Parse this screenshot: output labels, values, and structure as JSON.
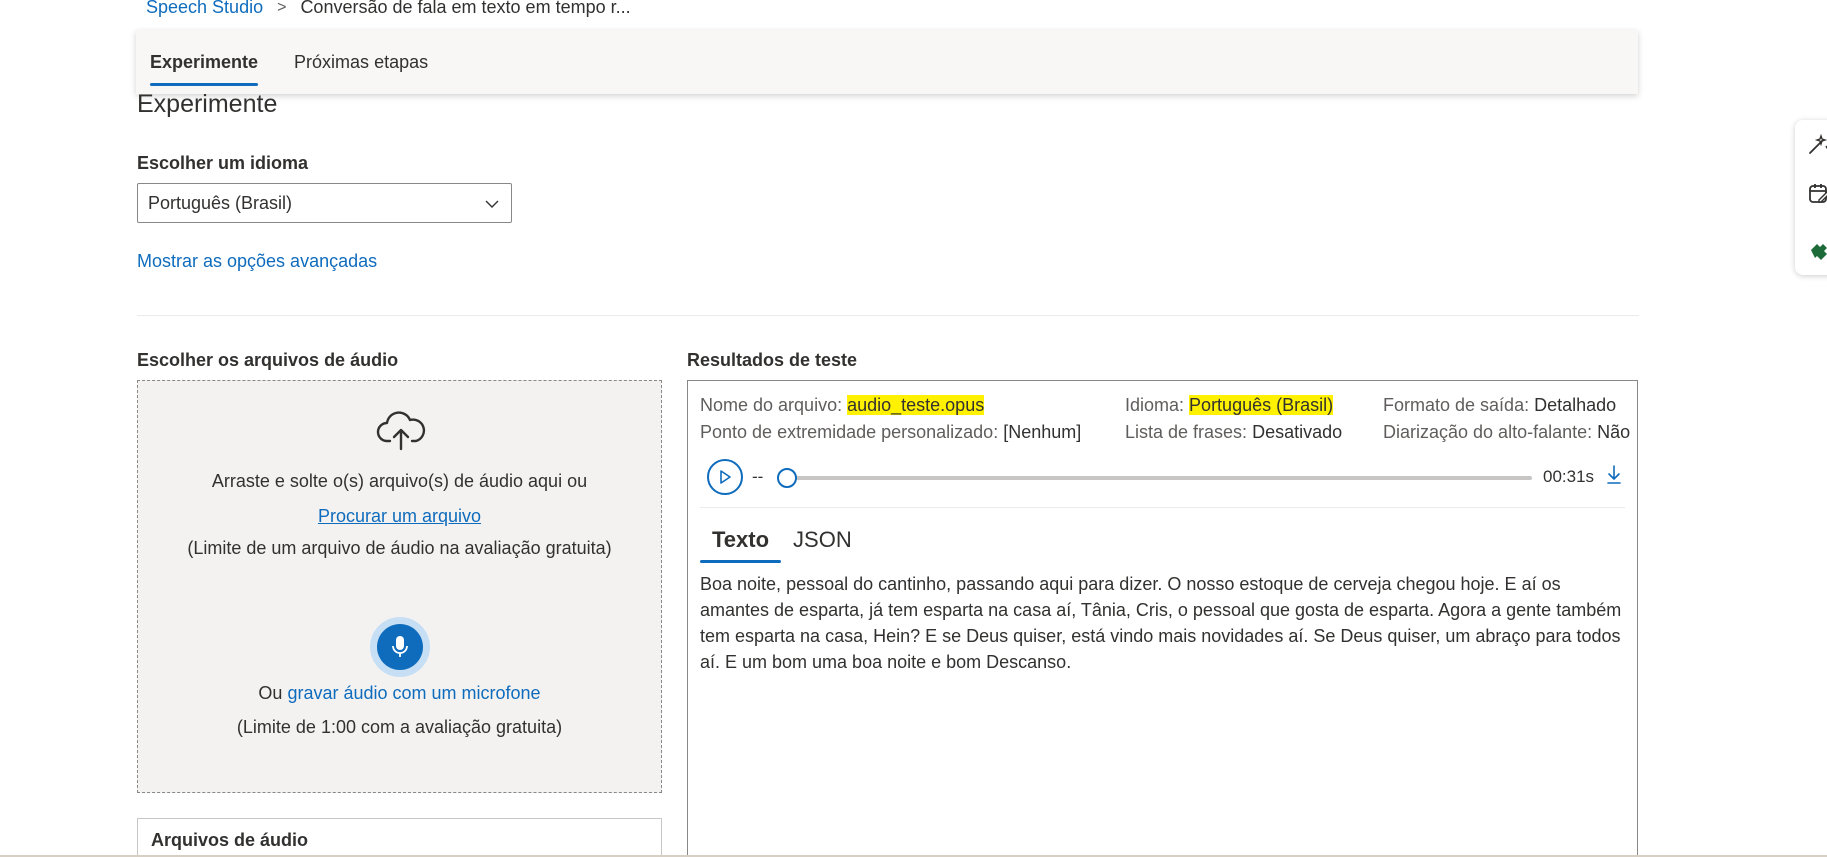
{
  "breadcrumb": {
    "root": "Speech Studio",
    "separator": ">",
    "current": "Conversão de fala em texto em tempo r..."
  },
  "tabs": [
    {
      "label": "Experimente",
      "active": true
    },
    {
      "label": "Próximas etapas",
      "active": false
    }
  ],
  "section": {
    "title": "Experimente",
    "language_label": "Escolher um idioma",
    "language_value": "Português (Brasil)",
    "advanced_link": "Mostrar as opções avançadas"
  },
  "upload": {
    "label": "Escolher os arquivos de áudio",
    "drag_text": "Arraste e solte o(s) arquivo(s) de áudio aqui ou",
    "browse_link": "Procurar um arquivo",
    "file_limit": "(Limite de um arquivo de áudio na avaliação gratuita)",
    "or_prefix": "Ou",
    "mic_link": "gravar áudio com um microfone",
    "mic_limit": "(Limite de 1:00 com a avaliação gratuita)",
    "audio_files_title": "Arquivos de áudio"
  },
  "results": {
    "label": "Resultados de teste",
    "file_name_label": "Nome do arquivo:",
    "file_name_value": "audio_teste.opus",
    "language_label": "Idioma:",
    "language_value": "Português (Brasil)",
    "output_format_label": "Formato de saída:",
    "output_format_value": "Detalhado",
    "endpoint_label": "Ponto de extremidade personalizado:",
    "endpoint_value": "[Nenhum]",
    "phrase_list_label": "Lista de frases:",
    "phrase_list_value": "Desativado",
    "diarization_label": "Diarização do alto-falante:",
    "diarization_value": "Não",
    "player": {
      "current": "--",
      "duration": "00:31s",
      "progress": 0
    },
    "tabs": [
      {
        "label": "Texto",
        "active": true
      },
      {
        "label": "JSON",
        "active": false
      }
    ],
    "transcript": "Boa noite, pessoal do cantinho, passando aqui para dizer. O nosso estoque de cerveja chegou hoje. E aí os amantes de esparta, já tem esparta na casa aí, Tânia, Cris, o pessoal que gosta de esparta. Agora a gente também tem esparta na casa, Hein? E se Deus quiser, está vindo mais novidades aí. Se Deus quiser, um abraço para todos aí. E um bom uma boa noite e bom Descanso."
  },
  "colors": {
    "accent": "#0f6cbd",
    "highlight": "#fff100",
    "dropzone_bg": "#f3f2f1"
  },
  "icons": [
    "chevron-down-icon",
    "cloud-upload-icon",
    "microphone-icon",
    "play-icon",
    "download-icon",
    "magic-wand-icon",
    "calendar-edit-icon",
    "puzzle-icon"
  ]
}
